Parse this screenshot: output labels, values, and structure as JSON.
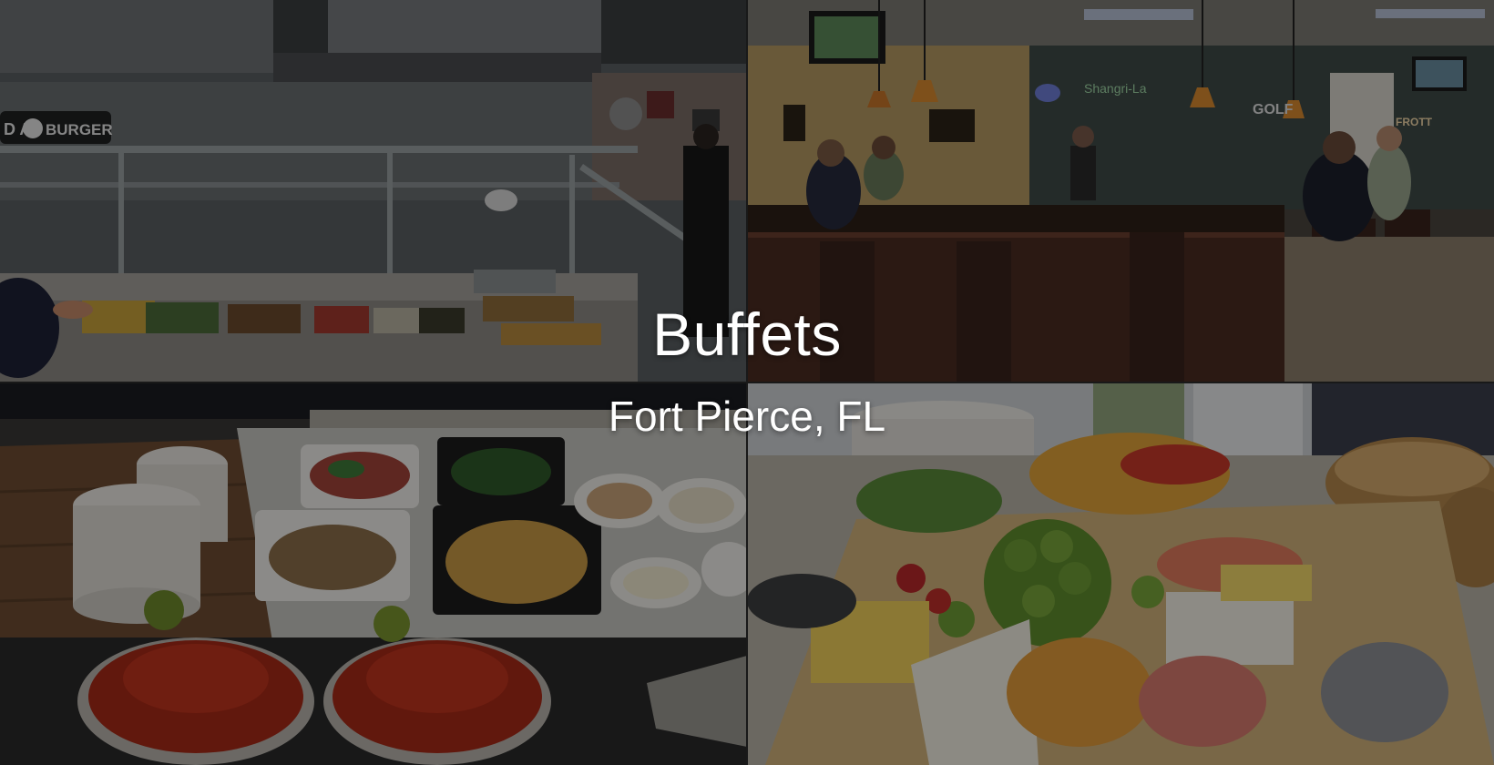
{
  "hero": {
    "title": "Buffets",
    "subtitle": "Fort Pierce, FL"
  },
  "photos": {
    "top_left": {
      "description": "buffet-serving-line",
      "sign_text": "D A BURGER"
    },
    "top_right": {
      "description": "bar-interior"
    },
    "bottom_left": {
      "description": "seafood-buffet-crawfish"
    },
    "bottom_right": {
      "description": "fruit-and-cheese-platter"
    }
  },
  "colors": {
    "overlay": "#000000",
    "text": "#ffffff"
  }
}
